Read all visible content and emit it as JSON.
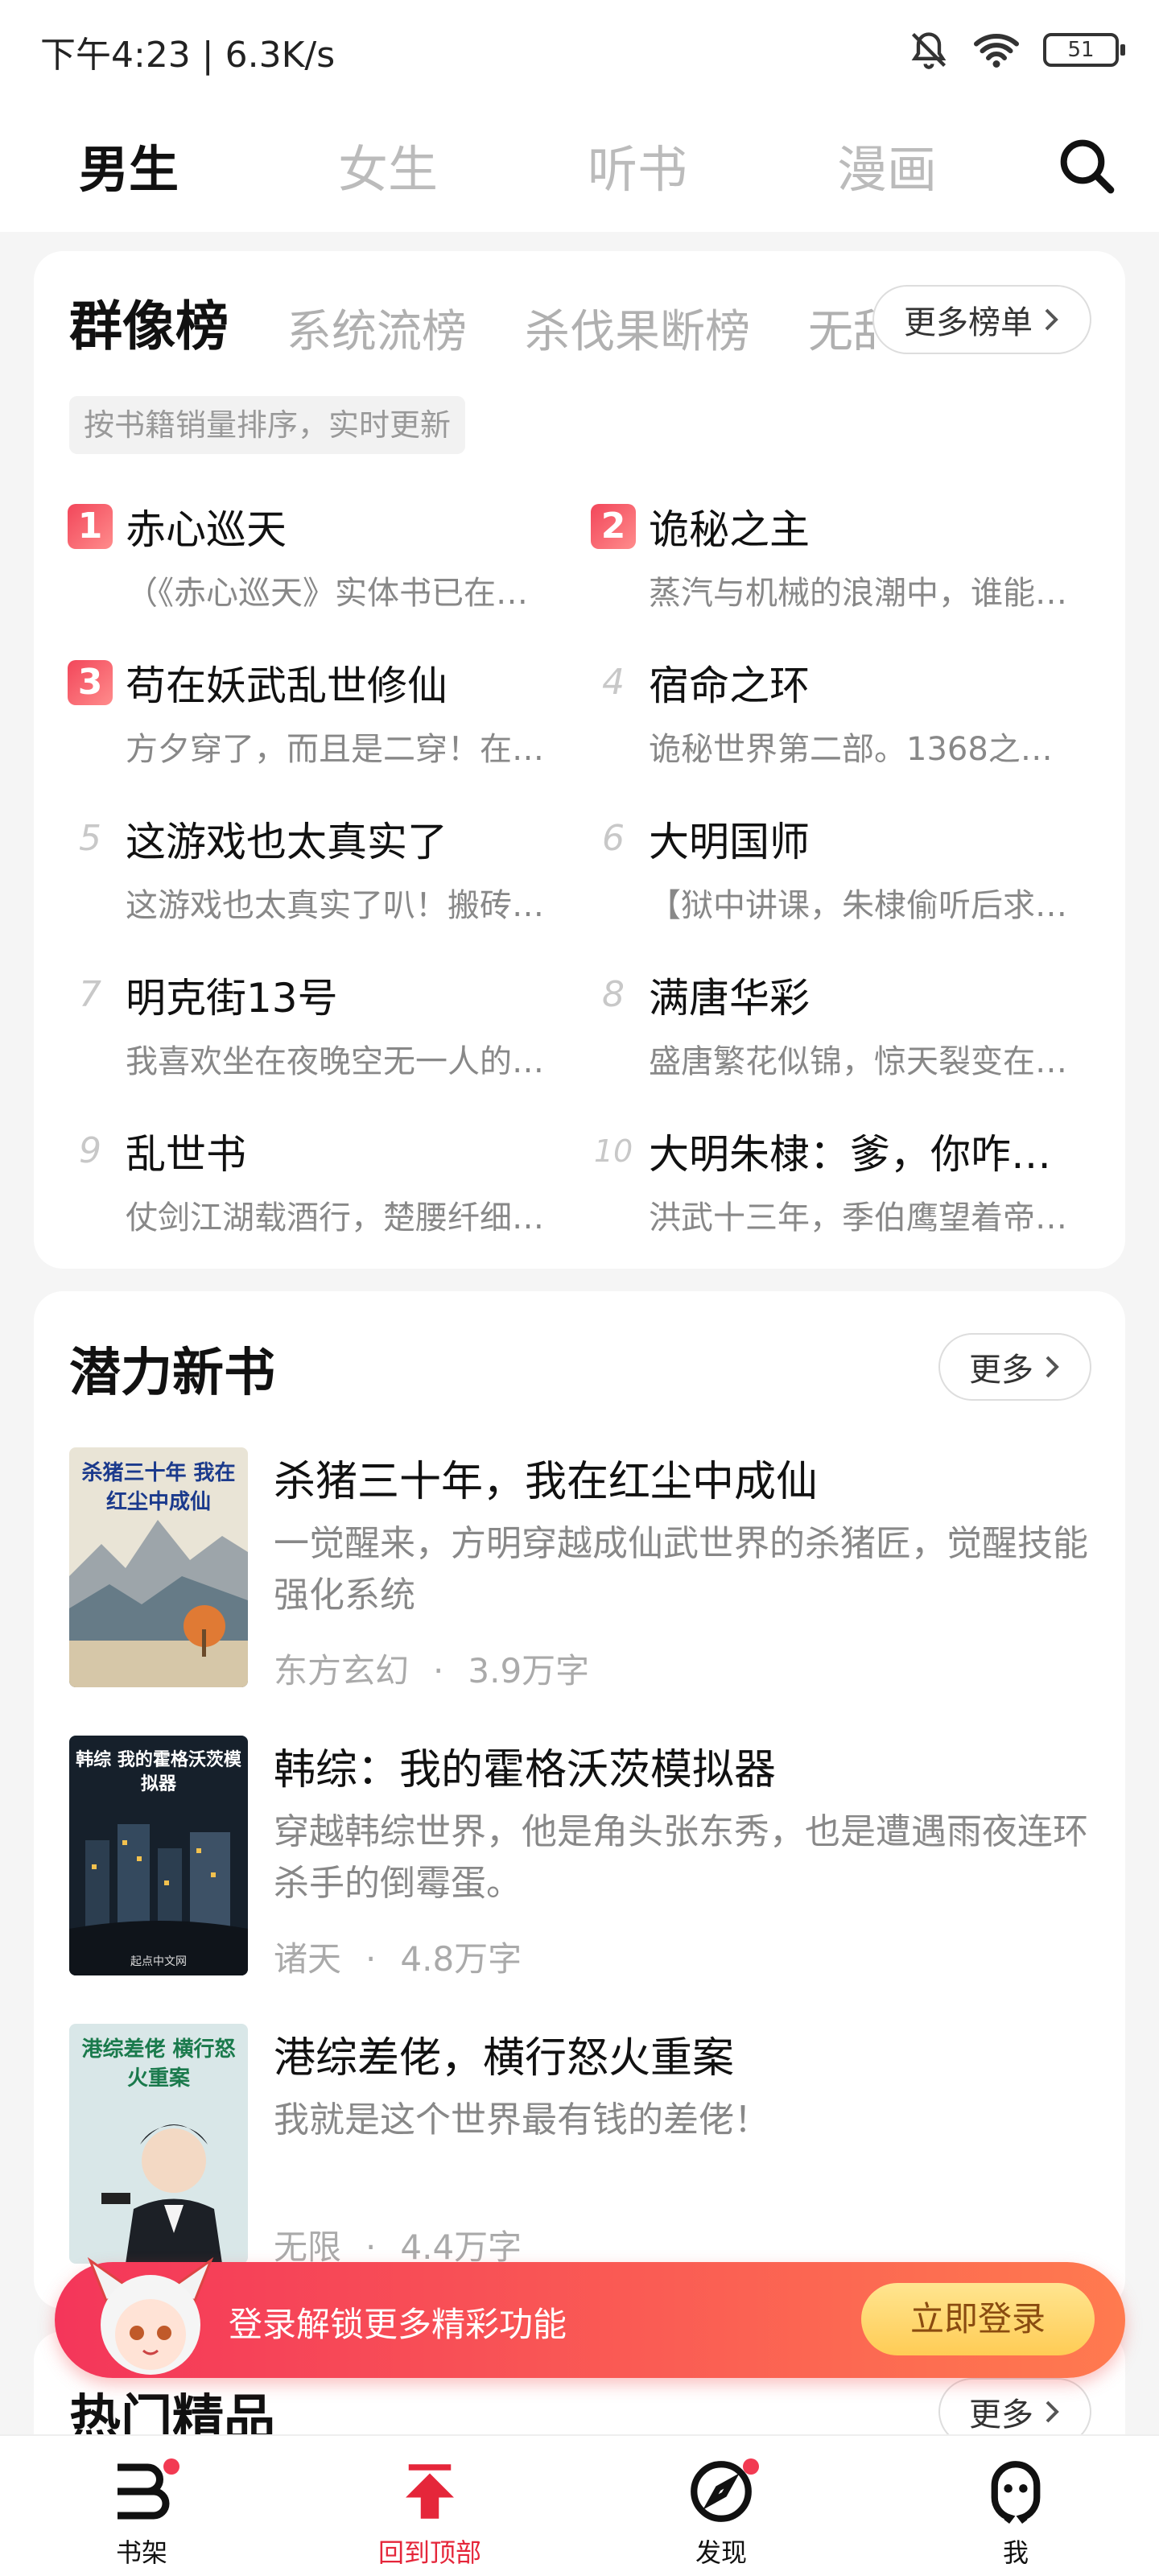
{
  "status_bar": {
    "left": "下午4:23 | 6.3K/s",
    "battery": "51"
  },
  "top_tabs": [
    "男生",
    "女生",
    "听书",
    "漫画"
  ],
  "ranking": {
    "tabs": [
      "群像榜",
      "系统流榜",
      "杀伐果断榜",
      "无敌"
    ],
    "more_label": "更多榜单",
    "note": "按书籍销量排序，实时更新",
    "items": [
      {
        "rank": "1",
        "title": "赤心巡天",
        "desc": "（《赤心巡天》实体书已在…"
      },
      {
        "rank": "2",
        "title": "诡秘之主",
        "desc": "蒸汽与机械的浪潮中，谁能…"
      },
      {
        "rank": "3",
        "title": "苟在妖武乱世修仙",
        "desc": "方夕穿了，而且是二穿！在…"
      },
      {
        "rank": "4",
        "title": "宿命之环",
        "desc": "诡秘世界第二部。1368之…"
      },
      {
        "rank": "5",
        "title": "这游戏也太真实了",
        "desc": "这游戏也太真实了叭！搬砖…"
      },
      {
        "rank": "6",
        "title": "大明国师",
        "desc": "【狱中讲课，朱棣偷听后求…"
      },
      {
        "rank": "7",
        "title": "明克街13号",
        "desc": "我喜欢坐在夜晚空无一人的…"
      },
      {
        "rank": "8",
        "title": "满唐华彩",
        "desc": "盛唐繁花似锦，惊天裂变在…"
      },
      {
        "rank": "9",
        "title": "乱世书",
        "desc": "仗剑江湖载酒行，楚腰纤细…"
      },
      {
        "rank": "10",
        "title": "大明朱棣：爹，你咋…",
        "desc": "洪武十三年，季伯鹰望着帝…"
      }
    ]
  },
  "new_books": {
    "title": "潜力新书",
    "more_label": "更多",
    "books": [
      {
        "title": "杀猪三十年，我在红尘中成仙",
        "desc": "一觉醒来，方明穿越成仙武世界的杀猪匠，觉醒技能强化系统",
        "genre": "东方玄幻",
        "words": "3.9万字",
        "cover_text": "杀猪三十年 我在红尘中成仙"
      },
      {
        "title": "韩综：我的霍格沃茨模拟器",
        "desc": "穿越韩综世界，他是角头张东秀，也是遭遇雨夜连环杀手的倒霉蛋。",
        "genre": "诸天",
        "words": "4.8万字",
        "cover_text": "韩综 我的霍格沃茨模拟器",
        "cover_brand": "起点中文网"
      },
      {
        "title": "港综差佬，横行怒火重案",
        "desc": "我就是这个世界最有钱的差佬！",
        "genre": "无限",
        "words": "4.4万字",
        "cover_text": "港综差佬 横行怒火重案"
      }
    ]
  },
  "hot": {
    "title": "热门精品",
    "more_label": "更多"
  },
  "login_banner": {
    "text": "登录解锁更多精彩功能",
    "button": "立即登录"
  },
  "bottom_nav": [
    "书架",
    "回到顶部",
    "发现",
    "我"
  ],
  "colors": {
    "accent": "#e5263a",
    "banner_start": "#f4365a",
    "banner_end": "#ff7a4f"
  }
}
